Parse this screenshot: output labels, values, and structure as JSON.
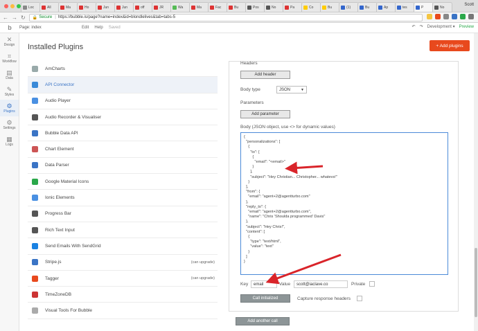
{
  "browser": {
    "tabs": [
      {
        "label": "Loc",
        "color": "#888"
      },
      {
        "label": "All",
        "color": "#d33"
      },
      {
        "label": "Ma",
        "color": "#d33"
      },
      {
        "label": "Ho",
        "color": "#d33"
      },
      {
        "label": "Jun",
        "color": "#d33"
      },
      {
        "label": "Jun",
        "color": "#d33"
      },
      {
        "label": "off",
        "color": "#d33"
      },
      {
        "label": "JR",
        "color": "#d33"
      },
      {
        "label": "Wa",
        "color": "#5b5"
      },
      {
        "label": "Ma",
        "color": "#d33"
      },
      {
        "label": "Fac",
        "color": "#d33"
      },
      {
        "label": "Bu",
        "color": "#d33"
      },
      {
        "label": "Pos",
        "color": "#555"
      },
      {
        "label": "No",
        "color": "#555"
      },
      {
        "label": "Pa",
        "color": "#d33"
      },
      {
        "label": "Co",
        "color": "#fc0"
      },
      {
        "label": "Bu",
        "color": "#fc0"
      },
      {
        "label": "(1)",
        "color": "#36c"
      },
      {
        "label": "Bu",
        "color": "#36c"
      },
      {
        "label": "Ap",
        "color": "#36c"
      },
      {
        "label": "tes",
        "color": "#36c"
      },
      {
        "label": "P",
        "color": "#36c"
      },
      {
        "label": "No",
        "color": "#555"
      }
    ],
    "active_tab_index": 21,
    "profile_name": "Scott",
    "secure_label": "Secure",
    "url": "https://bubble.is/page?name=index&id=blondlelives&tab=tabs-5"
  },
  "editor": {
    "page_label": "Page: index",
    "menu": [
      "Edit",
      "Help"
    ],
    "saved_label": "Saved",
    "mode_label": "Development",
    "preview_label": "Preview"
  },
  "sidebar": [
    {
      "label": "Design",
      "icon": "✕"
    },
    {
      "label": "Workflow",
      "icon": "⌗"
    },
    {
      "label": "Data",
      "icon": "▤"
    },
    {
      "label": "Styles",
      "icon": "✎"
    },
    {
      "label": "Plugins",
      "icon": "⚙"
    },
    {
      "label": "Settings",
      "icon": "⚙"
    },
    {
      "label": "Logs",
      "icon": "▦"
    }
  ],
  "main": {
    "title": "Installed Plugins",
    "add_plugins_label": "+ Add plugins",
    "plugins": [
      {
        "name": "AmCharts",
        "icon_color": "#9aa",
        "upgrade": ""
      },
      {
        "name": "API Connector",
        "icon_color": "#3a8ad8",
        "upgrade": ""
      },
      {
        "name": "Audio Player",
        "icon_color": "#4a90e2",
        "upgrade": ""
      },
      {
        "name": "Audio Recorder & Visualiser",
        "icon_color": "#555",
        "upgrade": ""
      },
      {
        "name": "Bubble Data API",
        "icon_color": "#3a74c5",
        "upgrade": ""
      },
      {
        "name": "Chart Element",
        "icon_color": "#c55",
        "upgrade": ""
      },
      {
        "name": "Data Parser",
        "icon_color": "#3a74c5",
        "upgrade": ""
      },
      {
        "name": "Google Material Icons",
        "icon_color": "#2aa84a",
        "upgrade": ""
      },
      {
        "name": "Ionic Elements",
        "icon_color": "#4a90e2",
        "upgrade": ""
      },
      {
        "name": "Progress Bar",
        "icon_color": "#555",
        "upgrade": ""
      },
      {
        "name": "Rich Text Input",
        "icon_color": "#555",
        "upgrade": ""
      },
      {
        "name": "Send Emails With SendGrid",
        "icon_color": "#1a82e2",
        "upgrade": ""
      },
      {
        "name": "Stripe.js",
        "icon_color": "#3a74c5",
        "upgrade": "(can upgrade)"
      },
      {
        "name": "Tagger",
        "icon_color": "#e8491d",
        "upgrade": "(can upgrade)"
      },
      {
        "name": "TimeZoneDB",
        "icon_color": "#c33",
        "upgrade": ""
      },
      {
        "name": "Visual Tools For Bubble",
        "icon_color": "#aaa",
        "upgrade": ""
      }
    ],
    "active_plugin_index": 1
  },
  "config": {
    "headers_label": "Headers",
    "add_header_label": "Add header",
    "body_type_label": "Body type",
    "body_type_value": "JSON",
    "parameters_label": "Parameters",
    "add_parameter_label": "Add parameter",
    "body_label": "Body (JSON object, use <> for dynamic values)",
    "body_text": "{\n  \"personalizations\": [\n    {\n      \"to\": [\n        {\n          \"email\": \"<email>\"\n        }\n      ],\n      \"subject\": \"Hey Christian... Christopher... whatevs!\"\n    }\n  ],\n  \"from\": {\n    \"email\": \"agent+2@agentturbo.com\"\n  },\n  \"reply_to\": {\n    \"email\": \"agent+2@agentturbo.com\",\n    \"name\": \"Chris 'Shoulda programmed' Davis\"\n  },\n  \"subject\": \"Hey Chris!\",\n  \"content\": [\n    {\n      \"type\": \"text/html\",\n      \"value\": \"text\"\n    }\n  ]\n}",
    "key_label": "Key",
    "key_value": "email",
    "value_label": "Value",
    "value_value": "scott@iaclave.co",
    "private_label": "Private",
    "call_initialized_label": "Call initialized",
    "capture_headers_label": "Capture response headers",
    "add_another_call_label": "Add another call"
  },
  "colors": {
    "accent_orange": "#e8491d",
    "annotation_red": "#d9242a",
    "link_blue": "#3a74c5"
  }
}
